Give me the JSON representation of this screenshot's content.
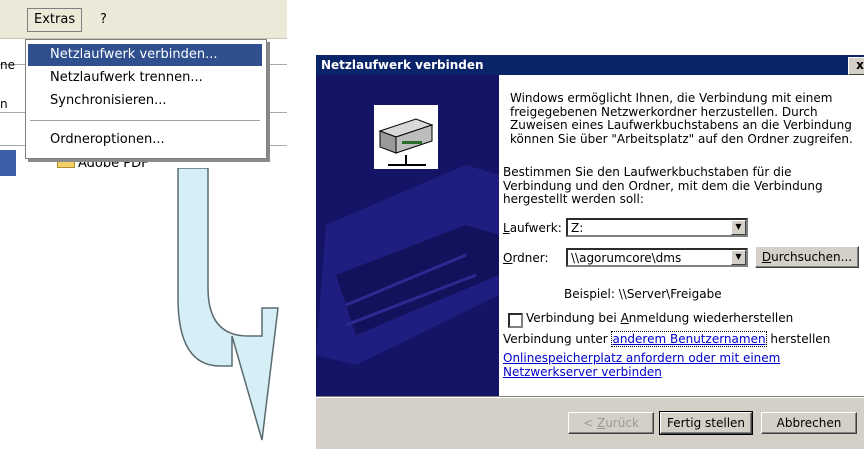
{
  "menubar": {
    "extras": "Extras",
    "help": "?"
  },
  "background": {
    "frag1": "ne",
    "frag2": "n",
    "folder": "Adobe PDF"
  },
  "menu": {
    "items": [
      {
        "label": "Netzlaufwerk verbinden..."
      },
      {
        "label": "Netzlaufwerk trennen..."
      },
      {
        "label": "Synchronisieren..."
      },
      {
        "label": "Ordneroptionen..."
      }
    ]
  },
  "dialog": {
    "title": "Netzlaufwerk verbinden",
    "close": "x",
    "intro": "Windows ermöglicht Ihnen, die Verbindung mit einem freigegebenen Netzwerkordner herzustellen. Durch Zuweisen eines Laufwerkbuchstabens an die Verbindung können Sie über \"Arbeitsplatz\" auf den Ordner zugreifen.",
    "instruction": "Bestimmen Sie den Laufwerkbuchstaben für die Verbindung und den Ordner, mit dem die Verbindung hergestellt werden soll:",
    "drive_label_u": "L",
    "drive_label_rest": "aufwerk:",
    "drive_value": "Z:",
    "folder_label_u": "O",
    "folder_label_rest": "rdner:",
    "folder_value": "\\\\agorumcore\\dms",
    "browse_u": "D",
    "browse_rest": "urchsuchen...",
    "example": "Beispiel: \\\\Server\\Freigabe",
    "reconnect_pre": "Verbindung bei ",
    "reconnect_u": "A",
    "reconnect_post": "nmeldung wiederherstellen",
    "other_user_pre": "Verbindung unter ",
    "other_user_link": "anderem Benutzernamen",
    "other_user_post": " herstellen",
    "online_link": "Onlinespeicherplatz anfordern oder mit einem Netzwerkserver verbinden",
    "back_pre": "< ",
    "back_u": "Z",
    "back_rest": "urück",
    "finish": "Fertig stellen",
    "cancel": "Abbrechen"
  }
}
